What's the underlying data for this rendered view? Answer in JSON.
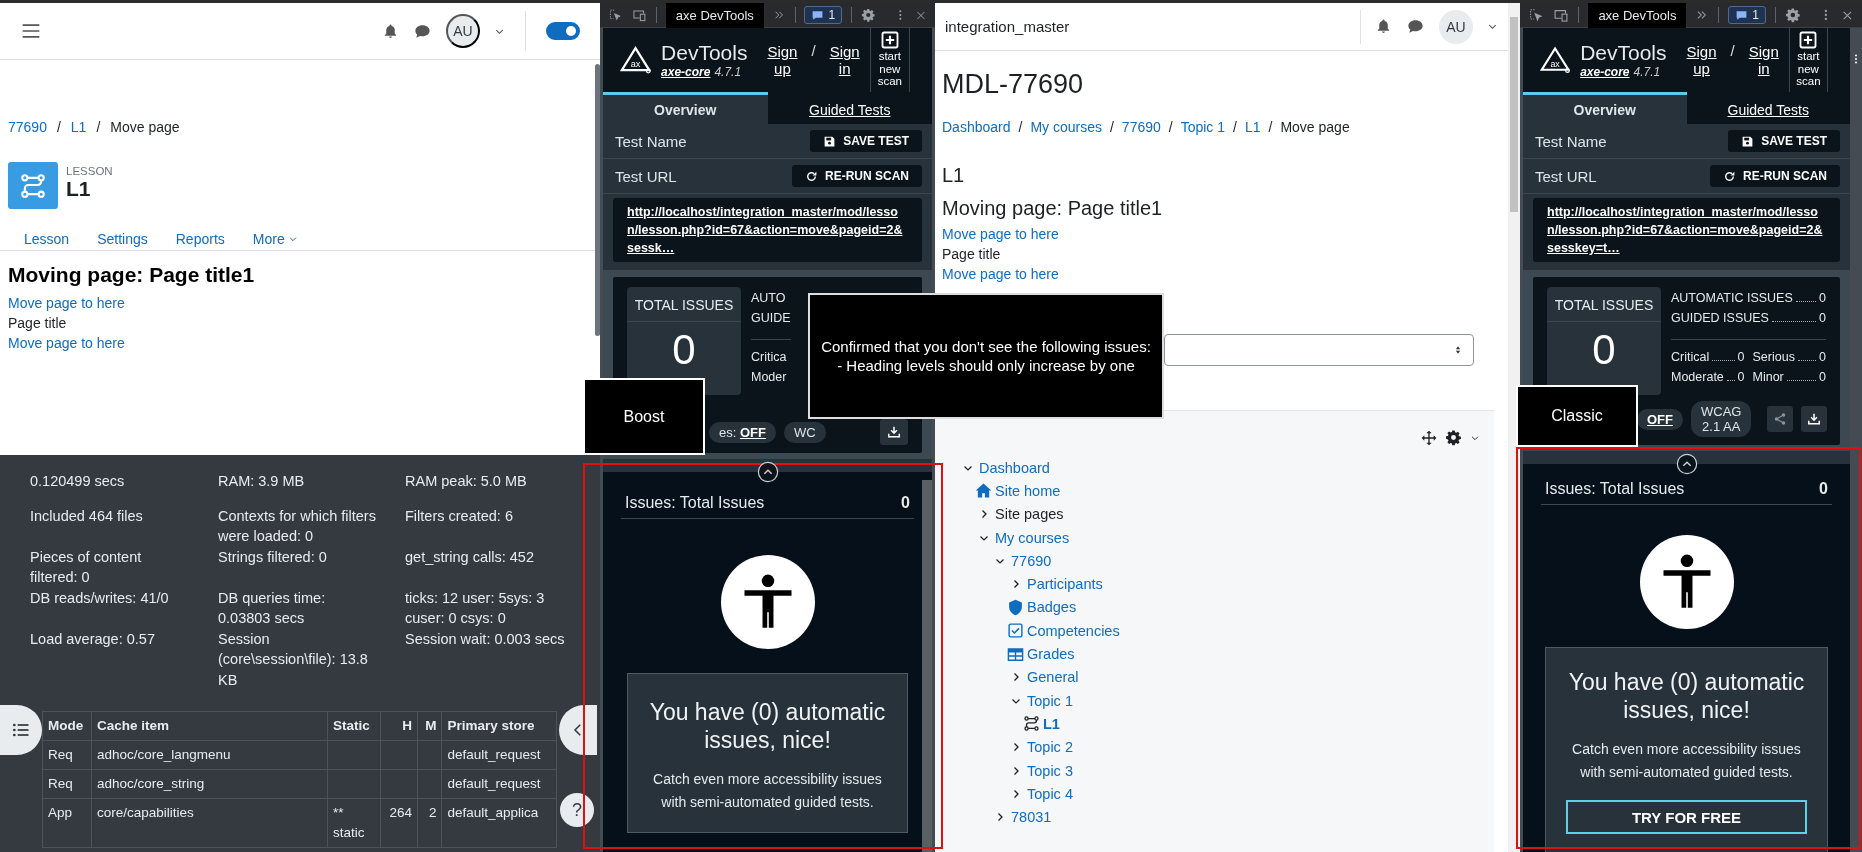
{
  "boost_page": {
    "header": {
      "avatar": "AU",
      "edit_mode": {
        "on": true
      }
    },
    "breadcrumb": [
      {
        "kind": "link",
        "label": "77690"
      },
      {
        "kind": "separator",
        "label": "/"
      },
      {
        "kind": "link",
        "label": "L1"
      },
      {
        "kind": "separator",
        "label": "/"
      },
      {
        "kind": "current",
        "label": "Move page"
      }
    ],
    "activity": {
      "type": "LESSON",
      "name": "L1"
    },
    "tabs": [
      {
        "label": "Lesson",
        "selected": false
      },
      {
        "label": "Settings",
        "selected": false
      },
      {
        "label": "Reports",
        "selected": false
      },
      {
        "label": "More",
        "selected": false
      }
    ],
    "heading": "Moving page: Page title1",
    "content": [
      {
        "kind": "link",
        "text": "Move page to here"
      },
      {
        "kind": "text",
        "text": "Page title"
      },
      {
        "kind": "link",
        "text": "Move page to here"
      }
    ],
    "performance": [
      "0.120499 secs",
      "RAM: 3.9 MB",
      "RAM peak: 5.0 MB",
      "Included 464 files",
      "Contexts for which filters were loaded: 0",
      "Filters created: 6",
      "Pieces of content filtered: 0",
      "Strings filtered: 0",
      "get_string calls: 452",
      "DB reads/writes: 41/0",
      "DB queries time: 0.03803 secs",
      "ticks: 12 user: 5sys: 3 cuser: 0 csys: 0",
      "Load average: 0.57",
      "Session (core\\session\\file): 13.8 KB",
      "Session wait: 0.003 secs"
    ],
    "cache_table": {
      "columns": [
        "Mode",
        "Cache item",
        "Static",
        "H",
        "M",
        "Primary store"
      ],
      "rows": [
        {
          "mode": "Req",
          "cache_item": "adhoc/core_langmenu",
          "primary_store": "default_request"
        },
        {
          "mode": "Req",
          "cache_item": "adhoc/core_string",
          "primary_store": "default_request"
        },
        {
          "mode": "App",
          "cache_item": "core/capabilities",
          "static": "** static",
          "h": "264",
          "m": "2",
          "primary_store": "default_applica"
        }
      ]
    },
    "help": "?"
  },
  "devtools": [
    {
      "tab": "axe DevTools",
      "badge": "1",
      "logo": "ax",
      "brand": "DevTools",
      "engine": "axe-core",
      "version": "4.7.1",
      "sign_up": "Sign up",
      "separator": "/",
      "sign_in": "Sign in",
      "new_scan": "start new scan",
      "tabs": [
        {
          "label": "Overview",
          "selected": true
        },
        {
          "label": "Guided Tests",
          "selected": false
        }
      ],
      "test_name_label": "Test Name",
      "save": "SAVE TEST",
      "test_url_label": "Test URL",
      "rerun": "RE-RUN SCAN",
      "url": "http://localhost/integration_master/mod/lesson/lesson.php?id=67&action=move&pageid=2&sessk…",
      "total_label": "TOTAL ISSUES",
      "total": "0",
      "summary": [
        {
          "label": "AUTO"
        },
        {
          "label": "GUIDE"
        }
      ],
      "severity": [
        {
          "label": "Critica"
        },
        {
          "label": "Moder"
        }
      ],
      "best_practices": {
        "label": "es:",
        "value": "OFF"
      },
      "standard": "WC",
      "issues_title": "Issues: Total Issues",
      "issues_count": "0",
      "card_title": "You have (0) automatic issues, nice!",
      "card_text": "Catch even more accessibility issues with semi-automated guided tests."
    },
    {
      "tab": "axe DevTools",
      "badge": "1",
      "logo": "ax",
      "brand": "DevTools",
      "engine": "axe-core",
      "version": "4.7.1",
      "sign_up": "Sign up",
      "separator": "/",
      "sign_in": "Sign in",
      "new_scan": "start new scan",
      "tabs": [
        {
          "label": "Overview",
          "selected": true
        },
        {
          "label": "Guided Tests",
          "selected": false
        }
      ],
      "test_name_label": "Test Name",
      "save": "SAVE TEST",
      "test_url_label": "Test URL",
      "rerun": "RE-RUN SCAN",
      "url": "http://localhost/integration_master/mod/lesson/lesson.php?id=67&action=move&pageid=2&sesskey=t…",
      "total_label": "TOTAL ISSUES",
      "total": "0",
      "summary": [
        {
          "label": "AUTOMATIC ISSUES",
          "value": "0"
        },
        {
          "label": "GUIDED ISSUES",
          "value": "0"
        }
      ],
      "severity": [
        {
          "label": "Critical",
          "value": "0"
        },
        {
          "label": "Serious",
          "value": "0"
        },
        {
          "label": "Moderate",
          "value": "0"
        },
        {
          "label": "Minor",
          "value": "0"
        }
      ],
      "best_practices": {
        "value": "OFF"
      },
      "standard": "WCAG 2.1 AA",
      "issues_title": "Issues: Total Issues",
      "issues_count": "0",
      "card_title": "You have (0) automatic issues, nice!",
      "card_text": "Catch even more accessibility issues with semi-automated guided tests.",
      "cta": "TRY FOR FREE"
    }
  ],
  "classic_page": {
    "site": "integration_master",
    "avatar": "AU",
    "title": "MDL-77690",
    "breadcrumb": [
      {
        "kind": "link",
        "label": "Dashboard"
      },
      {
        "kind": "separator",
        "label": "/"
      },
      {
        "kind": "link",
        "label": "My courses"
      },
      {
        "kind": "separator",
        "label": "/"
      },
      {
        "kind": "link",
        "label": "77690"
      },
      {
        "kind": "separator",
        "label": "/"
      },
      {
        "kind": "link",
        "label": "Topic 1"
      },
      {
        "kind": "separator",
        "label": "/"
      },
      {
        "kind": "link",
        "label": "L1"
      },
      {
        "kind": "separator",
        "label": "/"
      },
      {
        "kind": "current",
        "label": "Move page"
      }
    ],
    "activity_name": "L1",
    "heading": "Moving page: Page title1",
    "content": [
      {
        "kind": "link",
        "text": "Move page to here"
      },
      {
        "kind": "text",
        "text": "Page title"
      },
      {
        "kind": "link",
        "text": "Move page to here"
      }
    ],
    "tree": [
      {
        "kind": "branch",
        "label": "Dashboard",
        "link": true,
        "expanded": true,
        "children": [
          {
            "kind": "home",
            "label": "Site home",
            "link": true
          },
          {
            "kind": "branch",
            "label": "Site pages",
            "link": false,
            "expanded": false
          },
          {
            "kind": "branch",
            "label": "My courses",
            "link": true,
            "expanded": true,
            "children": [
              {
                "kind": "branch",
                "label": "77690",
                "link": true,
                "expanded": true,
                "children": [
                  {
                    "kind": "branch",
                    "label": "Participants",
                    "link": true,
                    "expanded": false
                  },
                  {
                    "kind": "badge",
                    "label": "Badges",
                    "link": true
                  },
                  {
                    "kind": "competency",
                    "label": "Competencies",
                    "link": true
                  },
                  {
                    "kind": "grades",
                    "label": "Grades",
                    "link": true
                  },
                  {
                    "kind": "branch",
                    "label": "General",
                    "link": true,
                    "expanded": false
                  },
                  {
                    "kind": "branch",
                    "label": "Topic 1",
                    "link": true,
                    "expanded": true,
                    "children": [
                      {
                        "kind": "activity",
                        "label": "L1",
                        "link": true,
                        "current": true
                      }
                    ]
                  },
                  {
                    "kind": "branch",
                    "label": "Topic 2",
                    "link": true,
                    "expanded": false
                  },
                  {
                    "kind": "branch",
                    "label": "Topic 3",
                    "link": true,
                    "expanded": false
                  },
                  {
                    "kind": "branch",
                    "label": "Topic 4",
                    "link": true,
                    "expanded": false
                  }
                ]
              },
              {
                "kind": "branch",
                "label": "78031",
                "link": true,
                "expanded": false
              }
            ]
          }
        ]
      }
    ]
  },
  "annotations": [
    {
      "kind": "label",
      "text": "Boost"
    },
    {
      "kind": "tooltip",
      "lines": [
        "Confirmed that you don't see the following issues:",
        "- Heading levels should only increase by one"
      ]
    },
    {
      "kind": "label",
      "text": "Classic"
    },
    {
      "kind": "frame"
    },
    {
      "kind": "frame"
    }
  ]
}
